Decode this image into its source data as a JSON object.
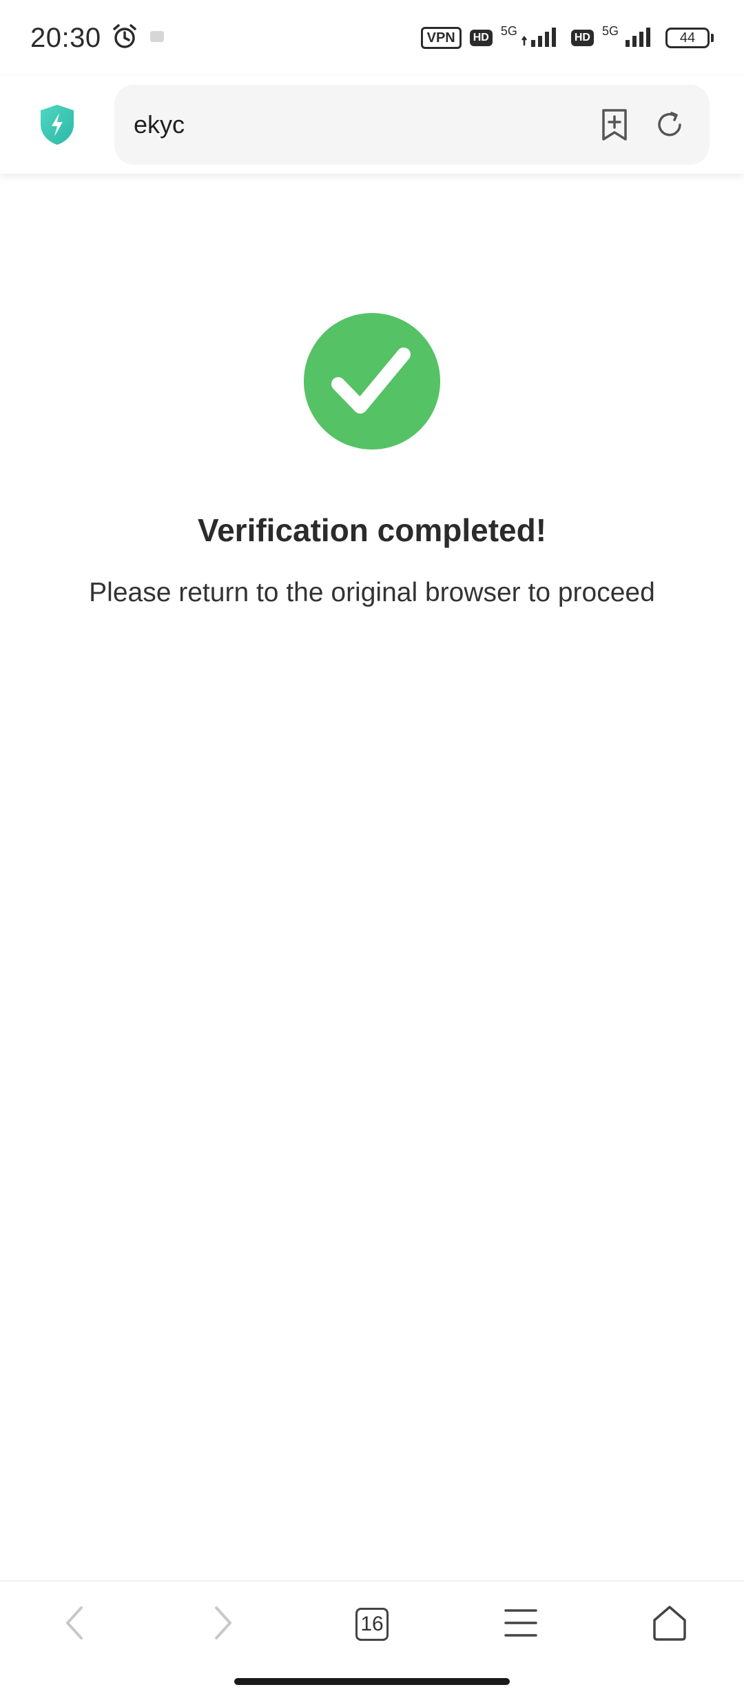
{
  "status_bar": {
    "time": "20:30",
    "vpn_label": "VPN",
    "hd_label": "HD",
    "network_1": "5G",
    "network_2": "5G",
    "battery": "44"
  },
  "address_bar": {
    "url": "ekyc",
    "shield_icon": "shield-lightning-icon",
    "bookmark_icon": "bookmark-add-icon",
    "reload_icon": "reload-icon",
    "accent_color": "#3fd0b8"
  },
  "content": {
    "title": "Verification completed!",
    "subtitle": "Please return to the original browser to proceed",
    "check_icon": "checkmark-icon",
    "check_color": "#55c265"
  },
  "bottom_nav": {
    "tab_count": "16",
    "back_icon": "chevron-left-icon",
    "forward_icon": "chevron-right-icon",
    "menu_icon": "hamburger-menu-icon",
    "home_icon": "home-icon"
  }
}
